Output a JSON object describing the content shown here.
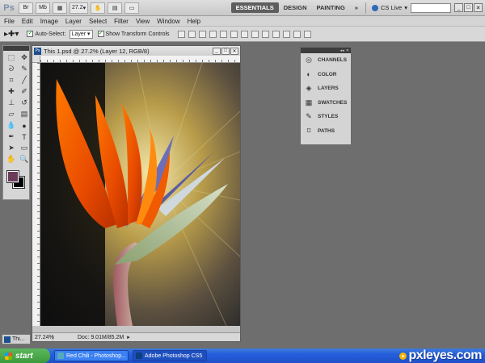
{
  "appbar": {
    "logo": "Ps",
    "bridge_label": "Br",
    "mini_bridge_label": "Mb",
    "zoom_value": "27.2",
    "workspaces": [
      "ESSENTIALS",
      "DESIGN",
      "PAINTING"
    ],
    "more_label": "»",
    "cs_live_label": "CS Live"
  },
  "menu": [
    "File",
    "Edit",
    "Image",
    "Layer",
    "Select",
    "Filter",
    "View",
    "Window",
    "Help"
  ],
  "options": {
    "auto_select_label": "Auto-Select:",
    "auto_select_value": "Layer",
    "transform_label": "Show Transform Controls"
  },
  "document": {
    "title": "This 1.psd @ 27.2% (Layer 12, RGB/8)",
    "zoom": "27.24%",
    "doc_info": "Doc: 9.01M/85.2M",
    "ruler_marks": [
      "0",
      "2",
      "4",
      "6",
      "8"
    ]
  },
  "panels": [
    {
      "label": "CHANNELS",
      "icon": "channels-icon"
    },
    {
      "label": "COLOR",
      "icon": "color-icon"
    },
    {
      "label": "LAYERS",
      "icon": "layers-icon"
    },
    {
      "label": "SWATCHES",
      "icon": "swatches-icon"
    },
    {
      "label": "STYLES",
      "icon": "styles-icon"
    },
    {
      "label": "PATHS",
      "icon": "paths-icon"
    }
  ],
  "minimized_doc": "Thi...",
  "taskbar": {
    "start_label": "start",
    "tasks": [
      {
        "label": "Red Chili - Photoshop...",
        "active": false
      },
      {
        "label": "Adobe Photoshop CS5",
        "active": true
      }
    ],
    "brand": "pxleyes.com"
  },
  "colors": {
    "foreground": "#6a3b5a",
    "background": "#000000",
    "active_workspace": "#5e5e5e"
  }
}
